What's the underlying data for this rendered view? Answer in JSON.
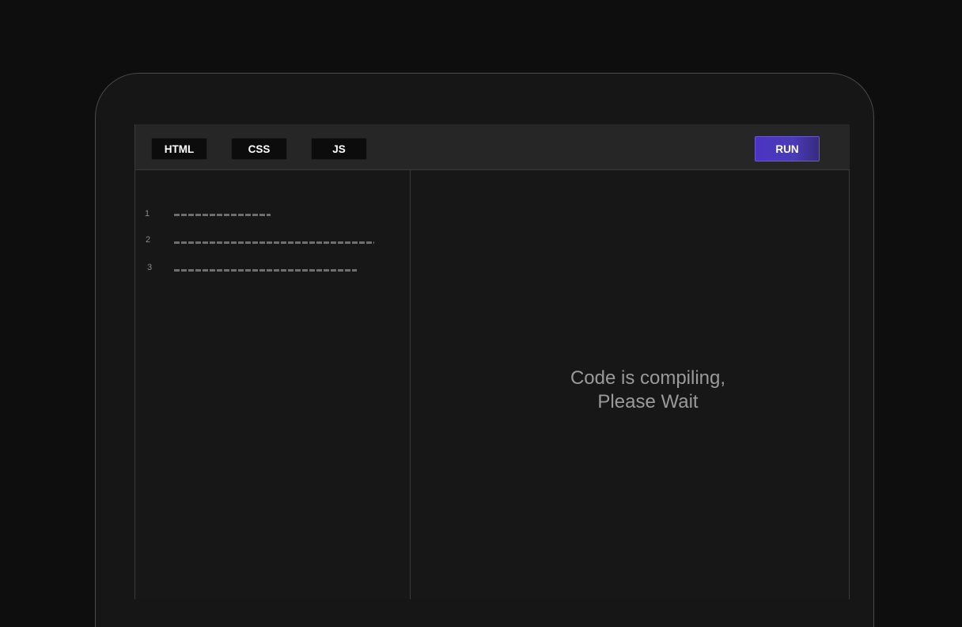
{
  "toolbar": {
    "tabs": [
      "HTML",
      "CSS",
      "JS"
    ],
    "run_label": "RUN"
  },
  "code": {
    "line_numbers": [
      "1",
      "2",
      "3"
    ]
  },
  "preview": {
    "message_line1": "Code is compiling,",
    "message_line2": "Please Wait"
  },
  "colors": {
    "accent": "#4b33c4",
    "background": "#0e0e0e",
    "panel": "#171717"
  }
}
